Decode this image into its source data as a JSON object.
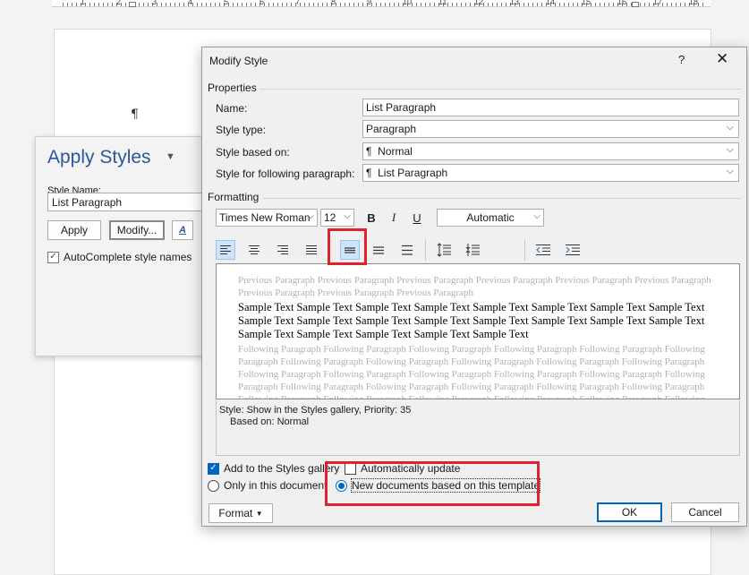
{
  "ruler": {
    "numbers": [
      "1",
      "2",
      "3",
      "4",
      "5",
      "6",
      "7",
      "8",
      "9",
      "10",
      "11",
      "12",
      "13",
      "14",
      "15",
      "16",
      "17",
      "18"
    ]
  },
  "document": {
    "pilcrow": "¶"
  },
  "apply_styles": {
    "title": "Apply Styles",
    "style_name_label": "Style Name:",
    "style_name_value": "List Paragraph",
    "apply_label": "Apply",
    "modify_label": "Modify...",
    "styles_icon_text": "A",
    "autocomplete_label": "AutoComplete style names",
    "autocomplete_checked": true
  },
  "dialog": {
    "title": "Modify Style",
    "help": "?",
    "close": "✕",
    "properties_heading": "Properties",
    "name_label": "Name:",
    "name_value": "List Paragraph",
    "style_type_label": "Style type:",
    "style_type_value": "Paragraph",
    "based_on_label": "Style based on:",
    "based_on_value": "¶  Normal",
    "following_label": "Style for following paragraph:",
    "following_value": "¶  List Paragraph",
    "formatting_heading": "Formatting",
    "font_value": "Times New Roman",
    "size_value": "12",
    "bold": "B",
    "italic": "I",
    "underline": "U",
    "color_value": "Automatic",
    "preview": {
      "previous": "Previous Paragraph Previous Paragraph Previous Paragraph Previous Paragraph Previous Paragraph Previous Paragraph Previous Paragraph Previous Paragraph Previous Paragraph",
      "sample": "Sample Text Sample Text Sample Text Sample Text Sample Text Sample Text Sample Text Sample Text Sample Text Sample Text Sample Text Sample Text Sample Text Sample Text Sample Text Sample Text Sample Text Sample Text Sample Text Sample Text Sample Text",
      "following": "Following Paragraph Following Paragraph Following Paragraph Following Paragraph Following Paragraph Following Paragraph Following Paragraph Following Paragraph Following Paragraph Following Paragraph Following Paragraph Following Paragraph Following Paragraph Following Paragraph Following Paragraph Following Paragraph Following Paragraph Following Paragraph Following Paragraph Following Paragraph Following Paragraph Following Paragraph Following Paragraph Following Paragraph Following Paragraph Following Paragraph Following Paragraph Following Paragraph Following Paragraph Following Paragraph"
    },
    "description_line1": "Style: Show in the Styles gallery, Priority: 35",
    "description_line2": "Based on: Normal",
    "add_to_gallery_label": "Add to the Styles gallery",
    "add_to_gallery_checked": true,
    "auto_update_label": "Automatically update",
    "auto_update_checked": false,
    "only_this_doc_label": "Only in this document",
    "new_docs_label": "New documents based on this template",
    "new_docs_selected": true,
    "format_label": "Format",
    "ok_label": "OK",
    "cancel_label": "Cancel"
  },
  "colors": {
    "accent": "#0067c0",
    "highlight": "#e0202e",
    "title_blue": "#2b579a"
  }
}
